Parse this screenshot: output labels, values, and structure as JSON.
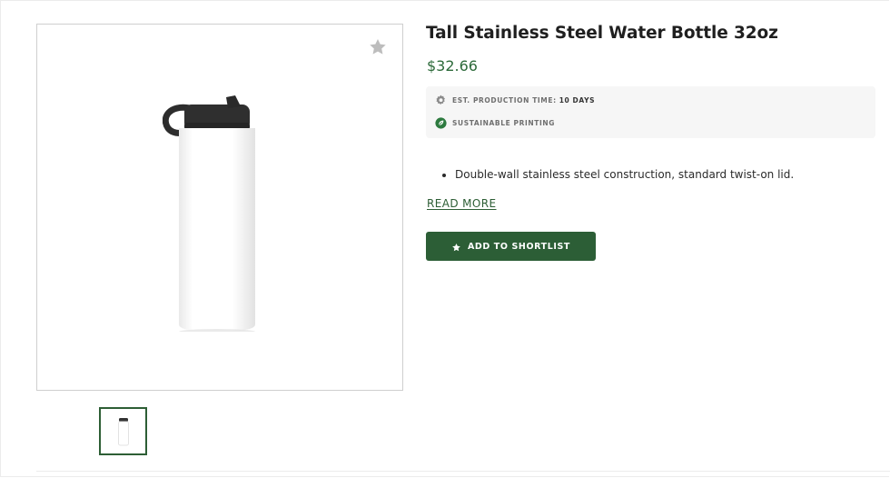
{
  "product": {
    "title": "Tall Stainless Steel Water Bottle 32oz",
    "price": "$32.66",
    "image_alt": "White tall stainless steel water bottle with black twist-on lid"
  },
  "info": {
    "production_label": "EST. PRODUCTION TIME:",
    "production_value": "10 DAYS",
    "production_icon": "gear-icon",
    "sustainable_label": "SUSTAINABLE PRINTING",
    "sustainable_icon": "leaf-icon"
  },
  "description": {
    "bullets": [
      "Double-wall stainless steel construction, standard twist-on lid."
    ],
    "read_more_label": "READ MORE"
  },
  "actions": {
    "favorite_icon": "star-icon",
    "shortlist_label": "ADD TO SHORTLIST",
    "shortlist_icon": "star-icon"
  },
  "colors": {
    "brand_green": "#2c5e36",
    "price_green": "#2d6a3a",
    "info_bg": "#f6f6f6"
  }
}
